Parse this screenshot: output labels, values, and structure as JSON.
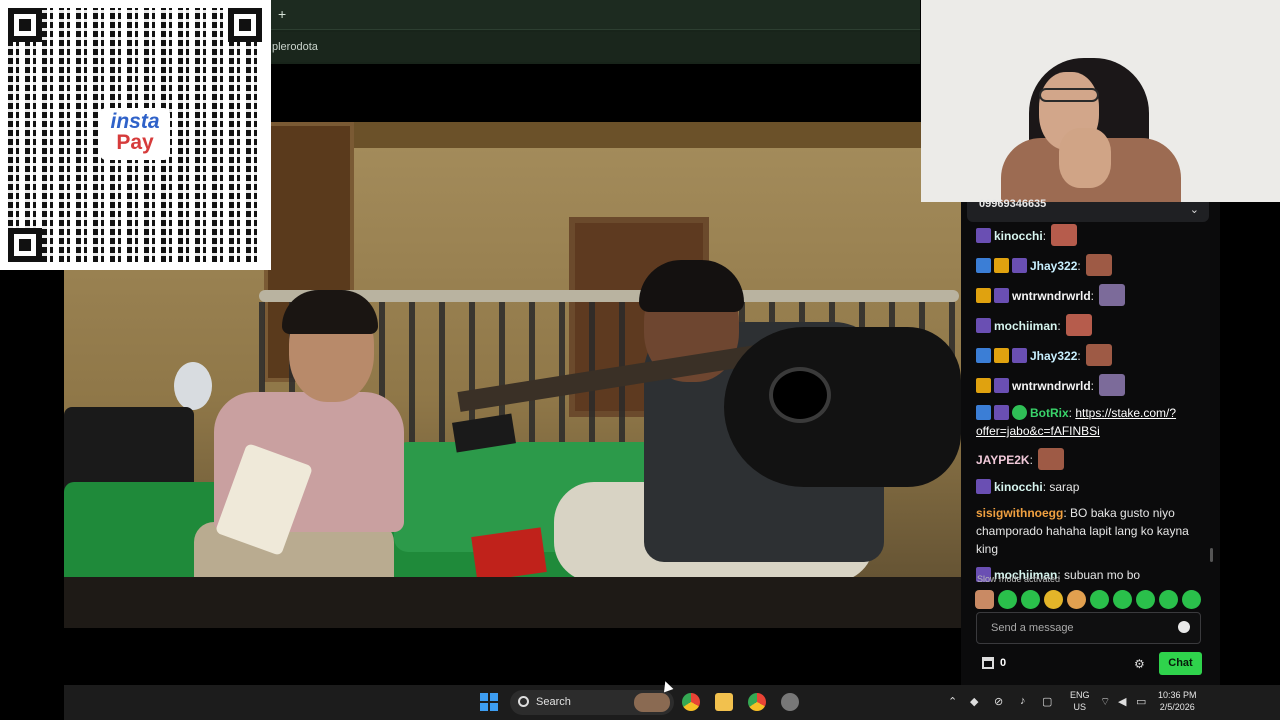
{
  "browser": {
    "new_tab_symbol": "+",
    "address_fragment": "plerodota"
  },
  "qr_overlay": {
    "brand_top": "insta",
    "brand_bottom": "Pay"
  },
  "chat": {
    "pinned_text": "09969346635",
    "messages": [
      {
        "user": "kinocchi",
        "user_color": "#d7f5ef",
        "badges": [
          "sub"
        ],
        "text": "",
        "emote": true
      },
      {
        "user": "Jhay322",
        "user_color": "#c9f0ff",
        "badges": [
          "pin",
          "crown",
          "sub"
        ],
        "text": "",
        "emote": true
      },
      {
        "user": "wntrwndrwrld",
        "user_color": "#f5f5f5",
        "badges": [
          "crown",
          "sub"
        ],
        "text": "",
        "emote": true
      },
      {
        "user": "mochiiman",
        "user_color": "#d7f5ef",
        "badges": [
          "sub"
        ],
        "text": "",
        "emote": true
      },
      {
        "user": "Jhay322",
        "user_color": "#c9f0ff",
        "badges": [
          "pin",
          "crown",
          "sub"
        ],
        "text": "",
        "emote": true
      },
      {
        "user": "wntrwndrwrld",
        "user_color": "#f5f5f5",
        "badges": [
          "crown",
          "sub"
        ],
        "text": "",
        "emote": true
      },
      {
        "user": "BotRix",
        "user_color": "#39d46a",
        "badges": [
          "pin",
          "sub",
          "verified"
        ],
        "text": "https://stake.com/?offer=jabo&c=fAFINBSi",
        "is_link": true
      },
      {
        "user": "JAYPE2K",
        "user_color": "#f0c9d9",
        "badges": [],
        "text": "",
        "emote": true
      },
      {
        "user": "kinocchi",
        "user_color": "#d7f5ef",
        "badges": [
          "sub"
        ],
        "text": "sarap"
      },
      {
        "user": "sisigwithnoegg",
        "user_color": "#f0a040",
        "badges": [],
        "text": "BO baka gusto niyo champorado hahaha lapit lang ko kayna king"
      },
      {
        "user": "mochiiman",
        "user_color": "#d7f5ef",
        "badges": [
          "sub"
        ],
        "text": "subuan mo bo"
      }
    ],
    "slow_mode_text": "Slow mode activated",
    "input_placeholder": "Send a message",
    "points_count": "0",
    "send_label": "Chat"
  },
  "taskbar": {
    "search_label": "Search",
    "lang_line1": "ENG",
    "lang_line2": "US",
    "time": "10:36 PM",
    "date": "2/5/2026"
  },
  "colors": {
    "chat_button": "#2fd34c",
    "chat_bg": "#0b0b0c",
    "taskbar_bg": "#1c1c1c"
  },
  "icons": [
    "windows-start-icon",
    "search-icon",
    "chrome-icon",
    "file-explorer-icon",
    "gear-icon",
    "store-icon",
    "emoji-icon",
    "chevron-down-icon",
    "wifi-icon",
    "volume-icon",
    "battery-icon"
  ]
}
